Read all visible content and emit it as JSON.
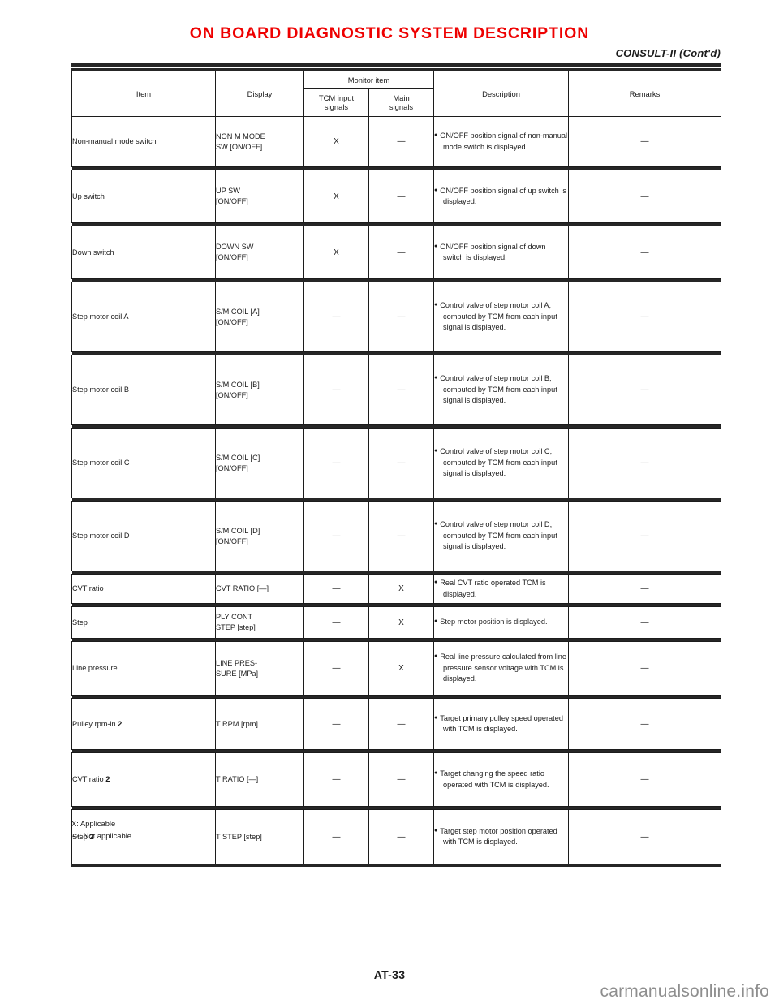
{
  "header": {
    "title": "ON BOARD DIAGNOSTIC SYSTEM DESCRIPTION",
    "subtitle": "CONSULT-II (Cont'd)",
    "title_color": "#ee0000"
  },
  "table": {
    "columns": {
      "item": "Item",
      "display": "Display",
      "monitor_item": "Monitor item",
      "tcm_input_signals": "TCM input\nsignals",
      "tcm_input_signals_l1": "TCM input",
      "tcm_input_signals_l2": "signals",
      "main_signals_l1": "Main",
      "main_signals_l2": "signals",
      "description": "Description",
      "remarks": "Remarks"
    },
    "rows": [
      {
        "item": "Non-manual mode switch",
        "display_l1": "NON M MODE",
        "display_l2": "SW [ON/OFF]",
        "tcm": "X",
        "main": "—",
        "description": "ON/OFF position signal of non-manual mode switch is displayed.",
        "remarks": "—"
      },
      {
        "item": "Up switch",
        "display_l1": "UP SW",
        "display_l2": "[ON/OFF]",
        "tcm": "X",
        "main": "—",
        "description": "ON/OFF position signal of up switch is displayed.",
        "remarks": "—"
      },
      {
        "item": "Down switch",
        "display_l1": "DOWN SW",
        "display_l2": "[ON/OFF]",
        "tcm": "X",
        "main": "—",
        "description": "ON/OFF position signal of down switch is displayed.",
        "remarks": "—"
      },
      {
        "item": "Step motor coil A",
        "display_l1": "S/M COIL [A]",
        "display_l2": "[ON/OFF]",
        "tcm": "—",
        "main": "—",
        "description": "Control valve of step motor coil A, computed by TCM from each input signal is displayed.",
        "remarks": "—"
      },
      {
        "item": "Step motor coil B",
        "display_l1": "S/M COIL [B]",
        "display_l2": "[ON/OFF]",
        "tcm": "—",
        "main": "—",
        "description": "Control valve of step motor coil B, computed by TCM from each input signal is displayed.",
        "remarks": "—"
      },
      {
        "item": "Step motor coil C",
        "display_l1": "S/M COIL [C]",
        "display_l2": "[ON/OFF]",
        "tcm": "—",
        "main": "—",
        "description": "Control valve of step motor coil C, computed by TCM from each input signal is displayed.",
        "remarks": "—"
      },
      {
        "item": "Step motor coil D",
        "display_l1": "S/M COIL [D]",
        "display_l2": "[ON/OFF]",
        "tcm": "—",
        "main": "—",
        "description": "Control valve of step motor coil D, computed by TCM from each input signal is displayed.",
        "remarks": "—"
      },
      {
        "item": "CVT ratio",
        "display_l1": "CVT RATIO [—]",
        "display_l2": "",
        "tcm": "—",
        "main": "X",
        "description": "Real CVT ratio operated TCM is displayed.",
        "remarks": "—"
      },
      {
        "item": "Step",
        "display_l1": "PLY CONT",
        "display_l2": "STEP [step]",
        "tcm": "—",
        "main": "X",
        "description": "Step motor position is displayed.",
        "remarks": "—"
      },
      {
        "item": "Line pressure",
        "display_l1": "LINE PRES-",
        "display_l2": "SURE [MPa]",
        "tcm": "—",
        "main": "X",
        "description": "Real line pressure calculated from line pressure sensor voltage with TCM is displayed.",
        "remarks": "—"
      },
      {
        "item": "Pulley rpm-in",
        "item_note": "2",
        "display_l1": "T RPM [rpm]",
        "display_l2": "",
        "tcm": "—",
        "main": "—",
        "description": "Target primary pulley speed operated with TCM is displayed.",
        "remarks": "—"
      },
      {
        "item": "CVT ratio",
        "item_note": "2",
        "display_l1": "T RATIO [—]",
        "display_l2": "",
        "tcm": "—",
        "main": "—",
        "description": "Target changing the speed ratio operated with TCM is displayed.",
        "remarks": "—"
      },
      {
        "item": "Step",
        "item_note": "2",
        "display_l1": "T STEP [step]",
        "display_l2": "",
        "tcm": "—",
        "main": "—",
        "description": "Target step motor position operated with TCM is displayed.",
        "remarks": "—"
      }
    ]
  },
  "footnotes": {
    "applicable": "X: Applicable",
    "not_applicable": "—: Not applicable"
  },
  "footer": {
    "page_number": "AT-33",
    "watermark": "carmanualsonline.info"
  }
}
